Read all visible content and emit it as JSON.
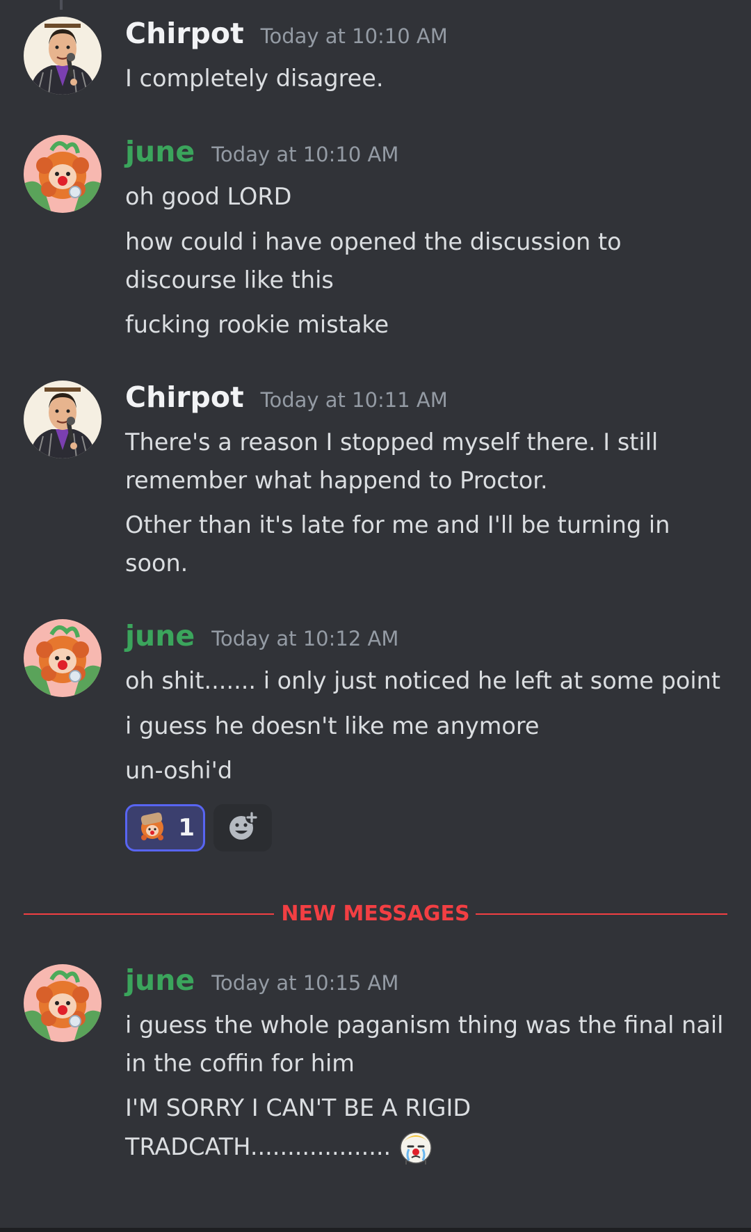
{
  "messages": [
    {
      "author": "Chirpot",
      "timestamp": "Today at 10:10 AM",
      "avatar": "chirpot-avatar",
      "lines": [
        "I completely disagree."
      ]
    },
    {
      "author": "june",
      "timestamp": "Today at 10:10 AM",
      "avatar": "june-avatar",
      "lines": [
        "oh good LORD",
        "how could i have opened the discussion to",
        "discourse like this",
        "fucking rookie mistake"
      ]
    },
    {
      "author": "Chirpot",
      "timestamp": "Today at 10:11 AM",
      "avatar": "chirpot-avatar",
      "lines": [
        "There's a reason I stopped myself there. I still",
        "remember what happend to Proctor.",
        "Other than it's late for me and I'll be turning in",
        "soon."
      ]
    },
    {
      "author": "june",
      "timestamp": "Today at 10:12 AM",
      "avatar": "june-avatar",
      "lines": [
        "oh shit....... i only just noticed he left at some point",
        "i guess he doesn't like me anymore",
        "un-oshi'd"
      ],
      "reactions": [
        {
          "emoji": "june-custom-emoji",
          "count": "1"
        }
      ],
      "add_reaction_icon": "add-reaction-icon"
    },
    {
      "author": "june",
      "timestamp": "Today at 10:15 AM",
      "avatar": "june-avatar",
      "lines": [
        "i guess the whole paganism thing was the final nail",
        "in the coffin for him",
        "I'M SORRY I CAN'T BE A RIGID",
        "TRADCATH..................."
      ],
      "inline_emoji": "crying-clown-emoji"
    }
  ],
  "divider": {
    "label": "NEW MESSAGES"
  },
  "colors": {
    "background": "#313338",
    "chirpot_name": "#f2f3f5",
    "june_name": "#3ba55c",
    "timestamp": "#949ba4",
    "message_text": "#dbdee1",
    "new_messages": "#f23f43",
    "reaction_active_border": "#5865f2"
  }
}
